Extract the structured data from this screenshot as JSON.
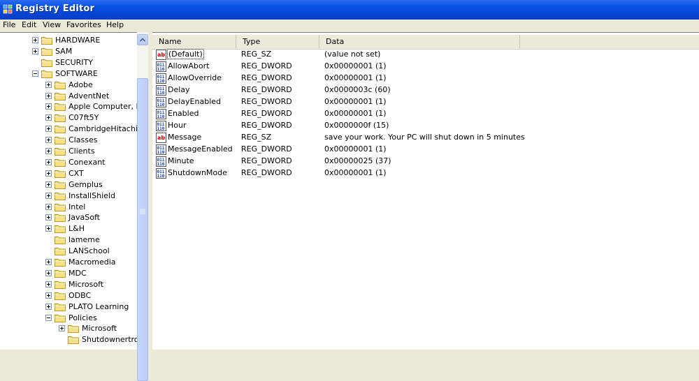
{
  "window": {
    "title": "Registry Editor"
  },
  "menu": [
    "File",
    "Edit",
    "View",
    "Favorites",
    "Help"
  ],
  "tree": [
    {
      "label": "HARDWARE",
      "level": 0,
      "expander": "plus"
    },
    {
      "label": "SAM",
      "level": 0,
      "expander": "plus"
    },
    {
      "label": "SECURITY",
      "level": 0,
      "expander": "none"
    },
    {
      "label": "SOFTWARE",
      "level": 0,
      "expander": "minus"
    },
    {
      "label": "Adobe",
      "level": 1,
      "expander": "plus"
    },
    {
      "label": "AdventNet",
      "level": 1,
      "expander": "plus"
    },
    {
      "label": "Apple Computer, Inc.",
      "level": 1,
      "expander": "plus"
    },
    {
      "label": "C07ft5Y",
      "level": 1,
      "expander": "plus"
    },
    {
      "label": "CambridgeHitachi",
      "level": 1,
      "expander": "plus"
    },
    {
      "label": "Classes",
      "level": 1,
      "expander": "plus"
    },
    {
      "label": "Clients",
      "level": 1,
      "expander": "plus"
    },
    {
      "label": "Conexant",
      "level": 1,
      "expander": "plus"
    },
    {
      "label": "CXT",
      "level": 1,
      "expander": "plus"
    },
    {
      "label": "Gemplus",
      "level": 1,
      "expander": "plus"
    },
    {
      "label": "InstallShield",
      "level": 1,
      "expander": "plus"
    },
    {
      "label": "Intel",
      "level": 1,
      "expander": "plus"
    },
    {
      "label": "JavaSoft",
      "level": 1,
      "expander": "plus"
    },
    {
      "label": "L&H",
      "level": 1,
      "expander": "plus"
    },
    {
      "label": "lameme",
      "level": 1,
      "expander": "none"
    },
    {
      "label": "LANSchool",
      "level": 1,
      "expander": "none"
    },
    {
      "label": "Macromedia",
      "level": 1,
      "expander": "plus"
    },
    {
      "label": "MDC",
      "level": 1,
      "expander": "plus"
    },
    {
      "label": "Microsoft",
      "level": 1,
      "expander": "plus"
    },
    {
      "label": "ODBC",
      "level": 1,
      "expander": "plus"
    },
    {
      "label": "PLATO Learning",
      "level": 1,
      "expander": "plus"
    },
    {
      "label": "Policies",
      "level": 1,
      "expander": "minus"
    },
    {
      "label": "Microsoft",
      "level": 2,
      "expander": "plus"
    },
    {
      "label": "Shutdownertron",
      "level": 2,
      "expander": "none"
    }
  ],
  "columns": {
    "name": "Name",
    "type": "Type",
    "data": "Data"
  },
  "values": [
    {
      "name": "(Default)",
      "type": "REG_SZ",
      "data": "(value not set)",
      "icon": "string-value-icon"
    },
    {
      "name": "AllowAbort",
      "type": "REG_DWORD",
      "data": "0x00000001 (1)",
      "icon": "binary-value-icon"
    },
    {
      "name": "AllowOverride",
      "type": "REG_DWORD",
      "data": "0x00000001 (1)",
      "icon": "binary-value-icon"
    },
    {
      "name": "Delay",
      "type": "REG_DWORD",
      "data": "0x0000003c (60)",
      "icon": "binary-value-icon"
    },
    {
      "name": "DelayEnabled",
      "type": "REG_DWORD",
      "data": "0x00000001 (1)",
      "icon": "binary-value-icon"
    },
    {
      "name": "Enabled",
      "type": "REG_DWORD",
      "data": "0x00000001 (1)",
      "icon": "binary-value-icon"
    },
    {
      "name": "Hour",
      "type": "REG_DWORD",
      "data": "0x0000000f (15)",
      "icon": "binary-value-icon"
    },
    {
      "name": "Message",
      "type": "REG_SZ",
      "data": "save your work. Your PC will shut down in 5 minutes",
      "icon": "string-value-icon"
    },
    {
      "name": "MessageEnabled",
      "type": "REG_DWORD",
      "data": "0x00000001 (1)",
      "icon": "binary-value-icon"
    },
    {
      "name": "Minute",
      "type": "REG_DWORD",
      "data": "0x00000025 (37)",
      "icon": "binary-value-icon"
    },
    {
      "name": "ShutdownMode",
      "type": "REG_DWORD",
      "data": "0x00000001 (1)",
      "icon": "binary-value-icon"
    }
  ]
}
